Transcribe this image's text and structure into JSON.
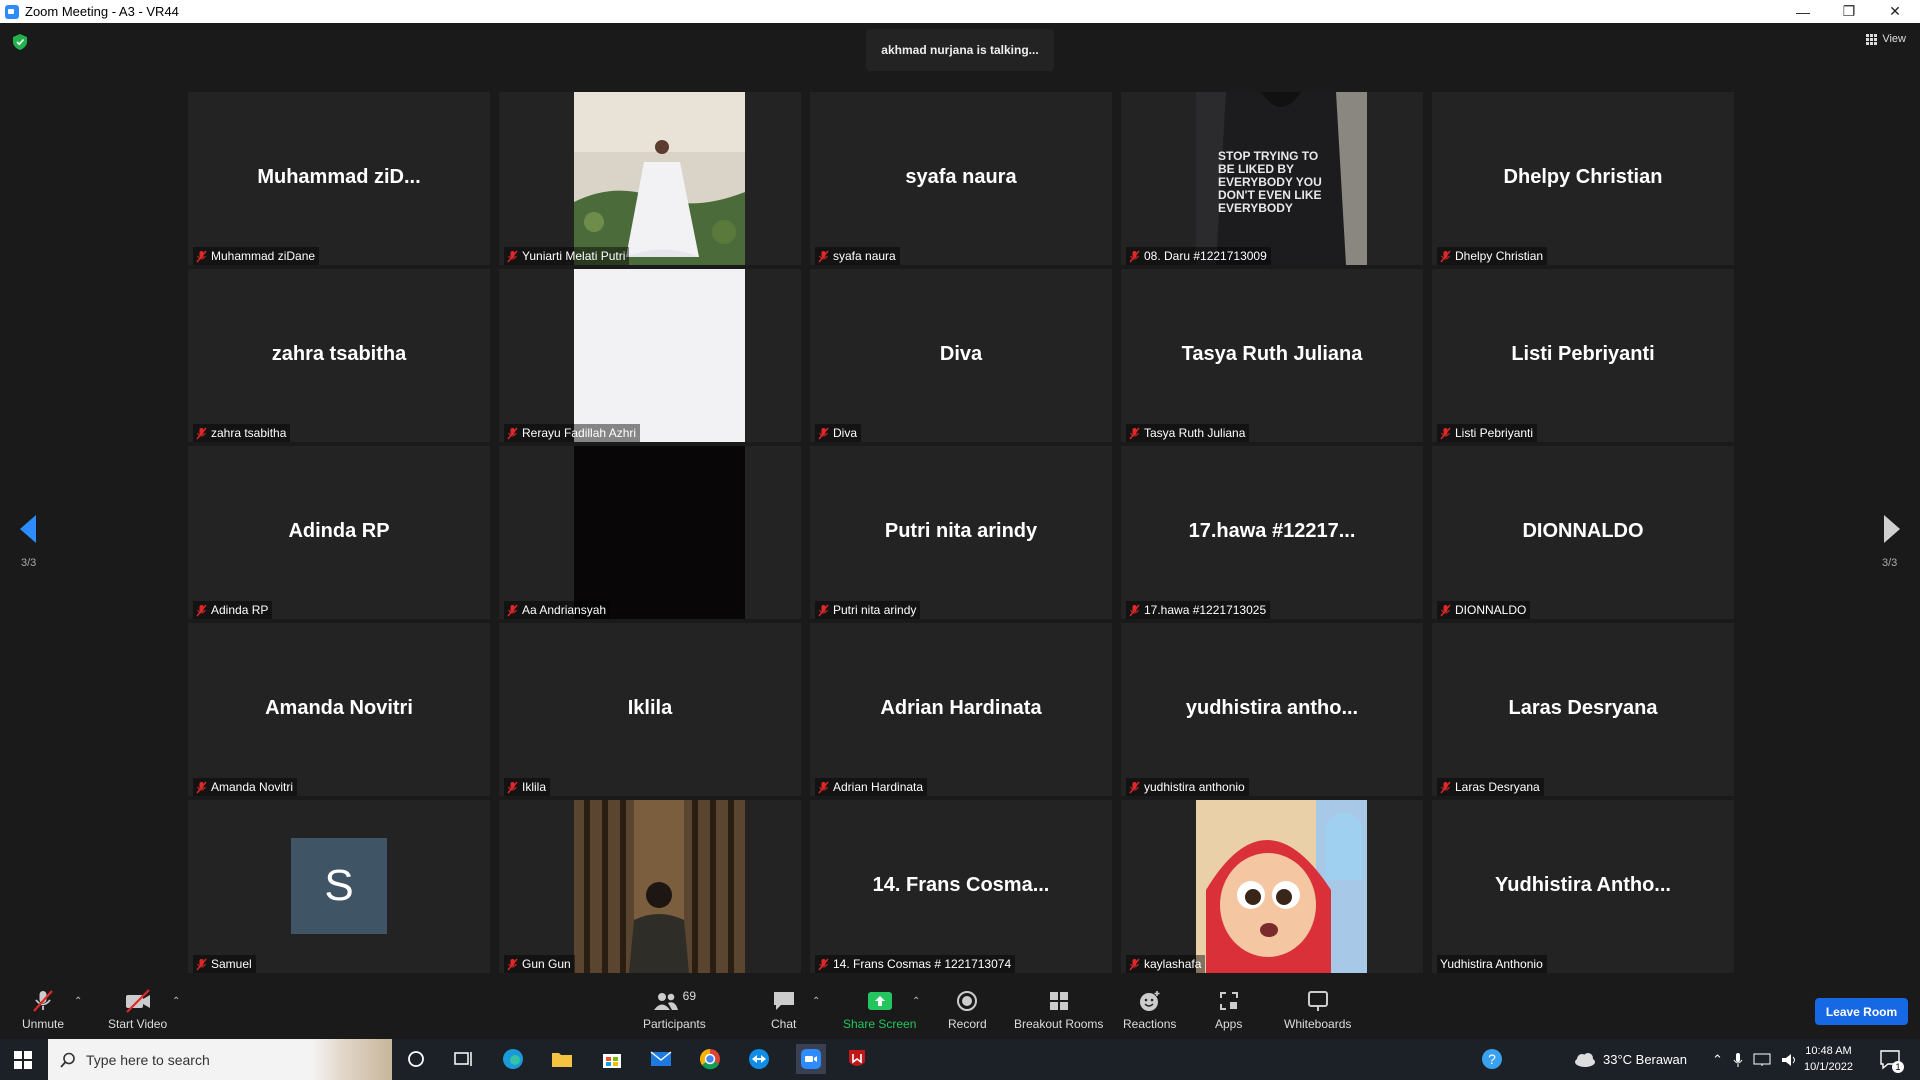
{
  "window": {
    "title": "Zoom Meeting - A3 - VR44"
  },
  "meeting": {
    "talking": "akhmad nurjana is talking...",
    "view_label": "View",
    "page_left": "3/3",
    "page_right": "3/3"
  },
  "tiles": [
    {
      "big": "Muhammad  ziD...",
      "name": "Muhammad ziDane"
    },
    {
      "big": "",
      "name": "Yuniarti Melati Putri"
    },
    {
      "big": "syafa naura",
      "name": "syafa naura"
    },
    {
      "big": "",
      "name": "08. Daru #1221713009"
    },
    {
      "big": "Dhelpy Christian",
      "name": "Dhelpy Christian"
    },
    {
      "big": "zahra tsabitha",
      "name": "zahra tsabitha"
    },
    {
      "big": "",
      "name": "Rerayu Fadillah Azhri"
    },
    {
      "big": "Diva",
      "name": "Diva"
    },
    {
      "big": "Tasya Ruth Juliana",
      "name": "Tasya Ruth Juliana"
    },
    {
      "big": "Listi Pebriyanti",
      "name": "Listi Pebriyanti"
    },
    {
      "big": "Adinda RP",
      "name": "Adinda RP"
    },
    {
      "big": "",
      "name": "Aa Andriansyah"
    },
    {
      "big": "Putri nita arindy",
      "name": "Putri nita arindy"
    },
    {
      "big": "17.hawa #12217...",
      "name": "17.hawa #1221713025"
    },
    {
      "big": "DIONNALDO",
      "name": "DIONNALDO"
    },
    {
      "big": "Amanda Novitri",
      "name": "Amanda Novitri"
    },
    {
      "big": "Iklila",
      "name": "Iklila"
    },
    {
      "big": "Adrian Hardinata",
      "name": "Adrian Hardinata"
    },
    {
      "big": "yudhistira  antho...",
      "name": "yudhistira anthonio"
    },
    {
      "big": "Laras Desryana",
      "name": "Laras Desryana"
    },
    {
      "big": "",
      "name": "Samuel",
      "avatar": "S"
    },
    {
      "big": "",
      "name": "Gun Gun"
    },
    {
      "big": "14. Frans Cosma...",
      "name": "14. Frans Cosmas # 1221713074"
    },
    {
      "big": "",
      "name": "kaylashafa"
    },
    {
      "big": "Yudhistira  Antho...",
      "name": "Yudhistira Anthonio"
    }
  ],
  "hoodie_text": "STOP TRYING TO BE LIKED BY EVERYBODY YOU DON'T EVEN LIKE EVERYBODY",
  "toolbar": {
    "unmute": "Unmute",
    "start_video": "Start Video",
    "participants": "Participants",
    "participants_count": "69",
    "chat": "Chat",
    "share_screen": "Share Screen",
    "record": "Record",
    "breakout": "Breakout Rooms",
    "reactions": "Reactions",
    "apps": "Apps",
    "whiteboards": "Whiteboards",
    "leave": "Leave Room"
  },
  "taskbar": {
    "search_placeholder": "Type here to search",
    "weather": "33°C  Berawan",
    "time": "10:48 AM",
    "date": "10/1/2022",
    "notif_count": "1"
  },
  "colors": {
    "accent": "#2d8cff",
    "leave": "#1768e5",
    "share": "#22c55e",
    "muted": "#e02828"
  }
}
